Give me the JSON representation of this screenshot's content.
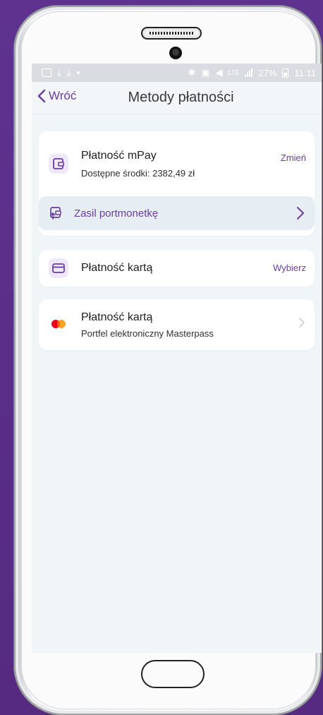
{
  "statusbar": {
    "battery": "27%",
    "time": "11:11",
    "network": "LTE"
  },
  "nav": {
    "back_label": "Wróć",
    "title": "Metody płatności"
  },
  "mpay": {
    "title": "Płatność mPay",
    "balance": "Dostępne środki: 2382,49 zł",
    "action": "Zmień",
    "topup_label": "Zasil portmonetkę"
  },
  "card_payment": {
    "title": "Płatność kartą",
    "action": "Wybierz"
  },
  "masterpass": {
    "title": "Płatność kartą",
    "subtitle": "Portfel elektroniczny Masterpass"
  },
  "colors": {
    "accent": "#6a3fa0",
    "background": "#5b2f86",
    "screen_bg": "#f0f5f8"
  }
}
